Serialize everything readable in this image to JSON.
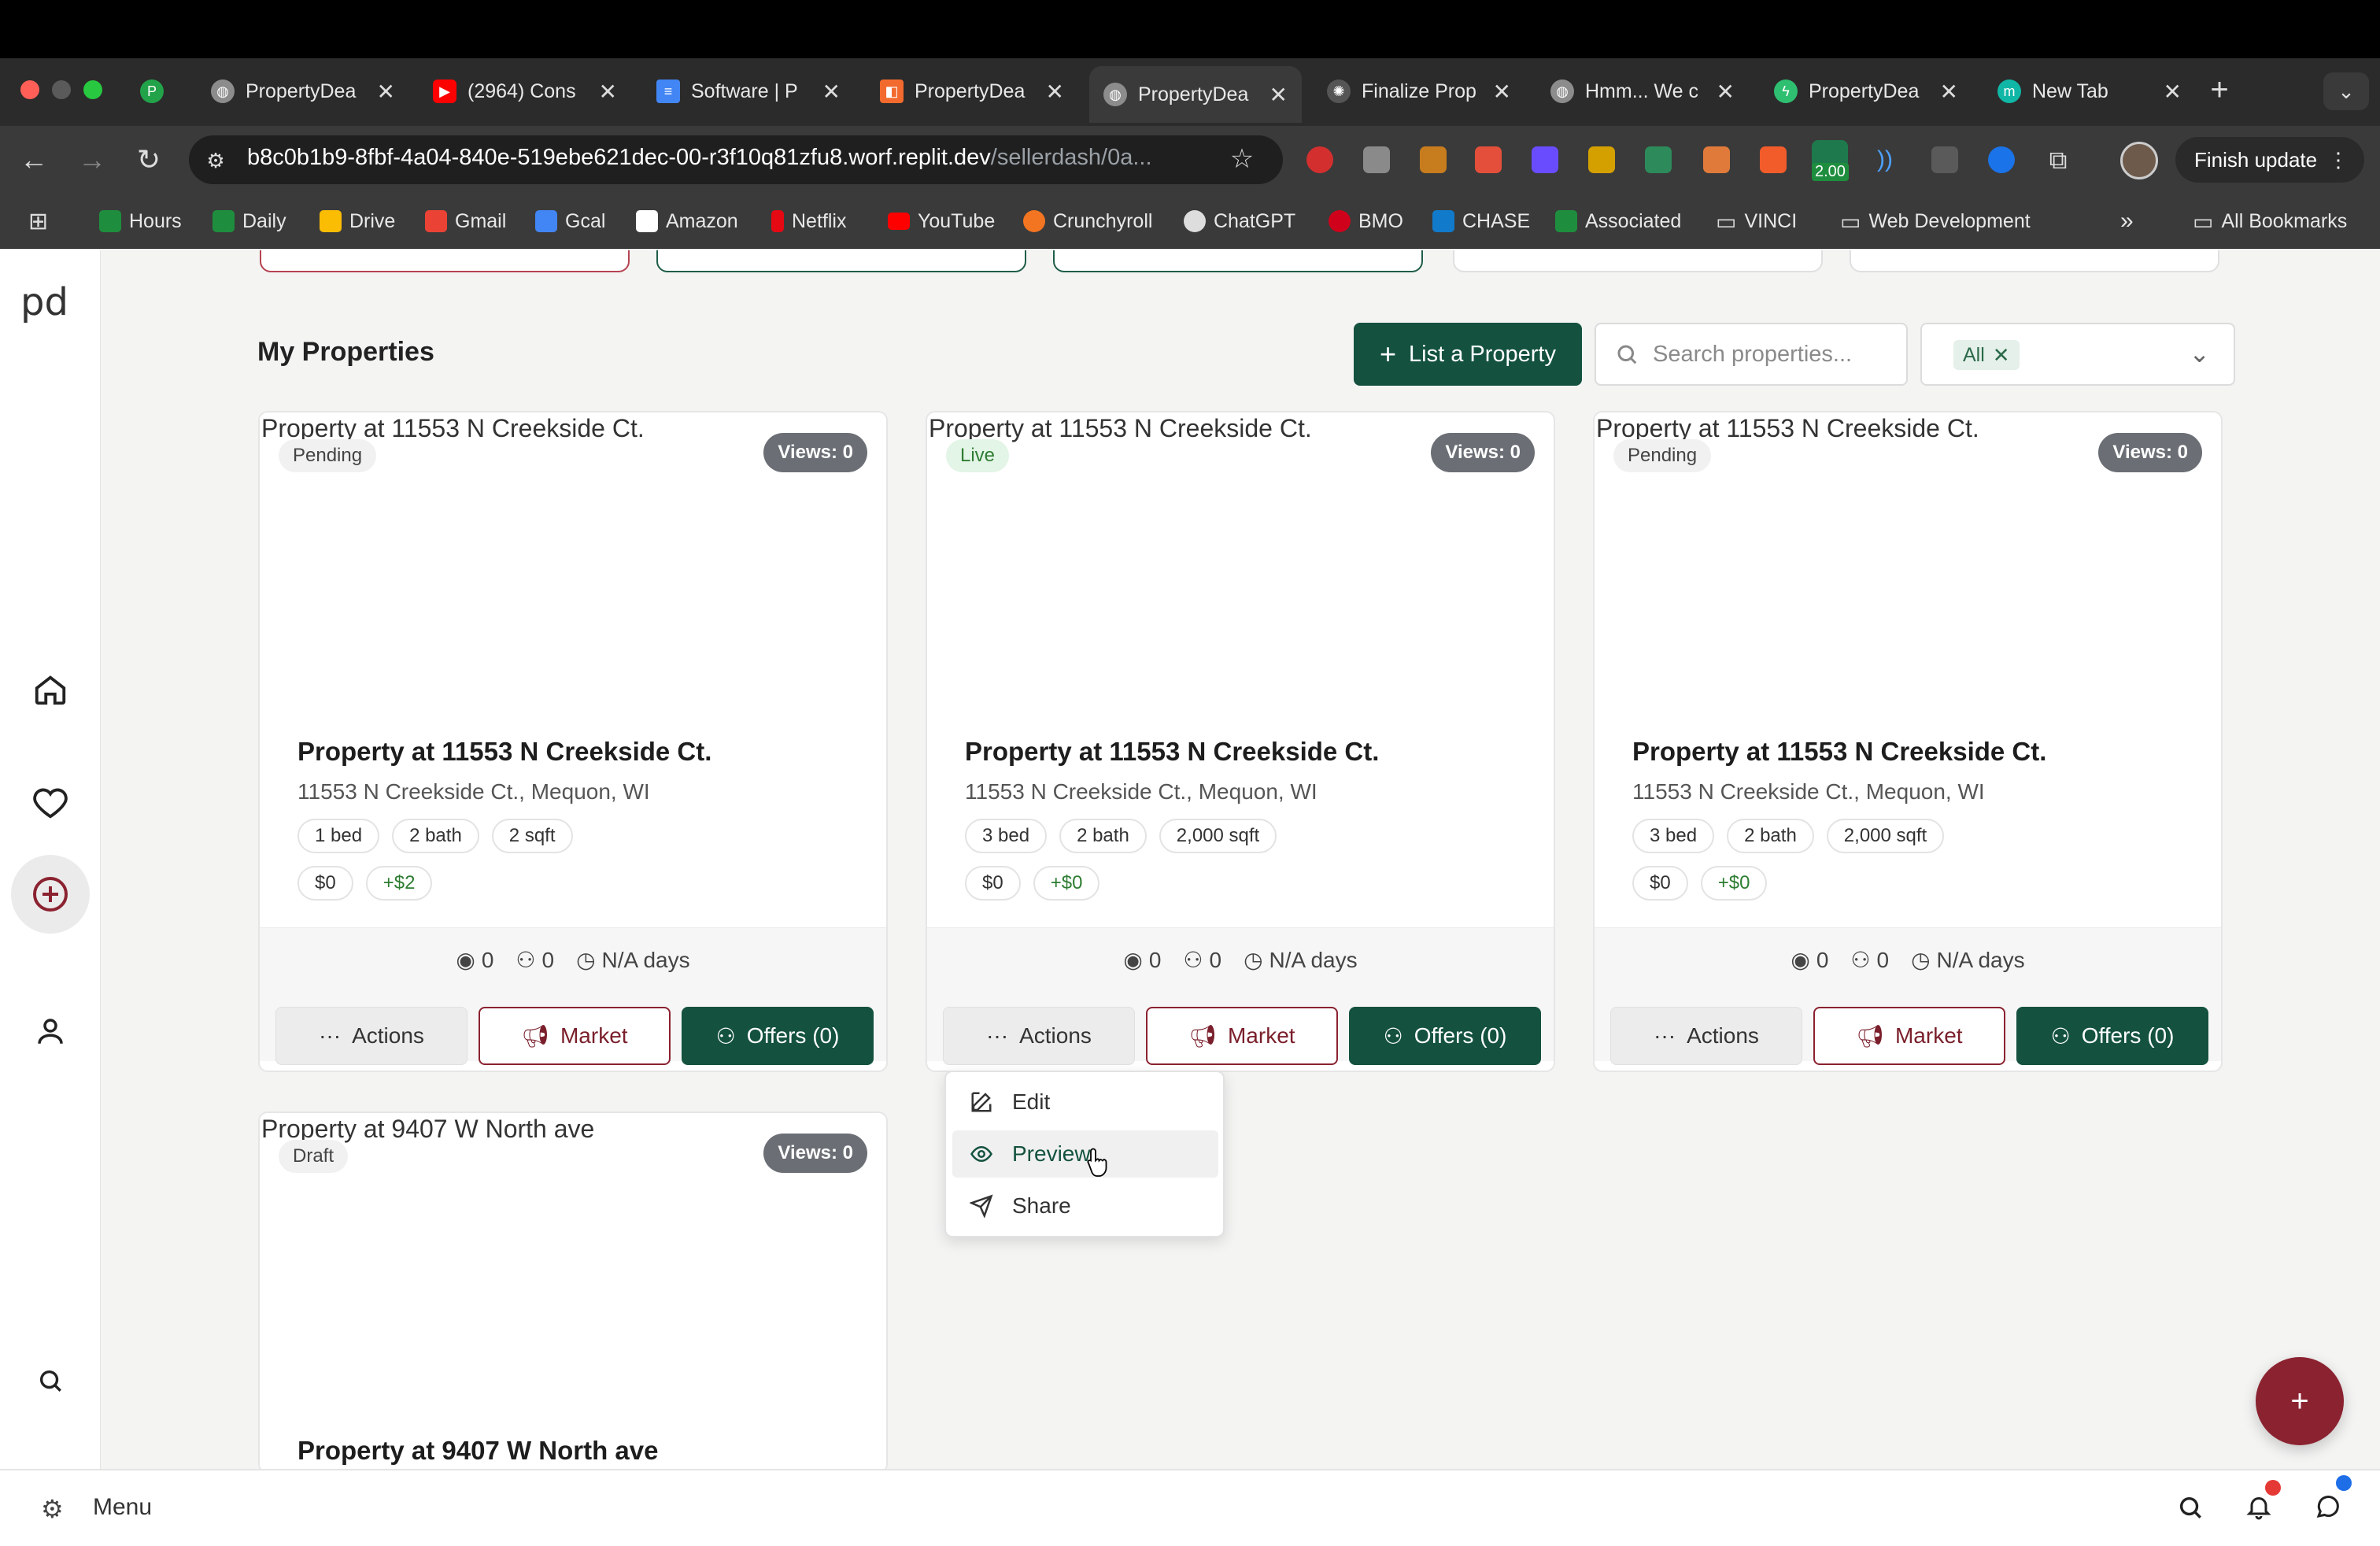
{
  "browser": {
    "tabs": [
      {
        "title": "",
        "favicon_color": "#22a34a",
        "favicon_letter": "P"
      },
      {
        "title": "PropertyDea",
        "favicon_color": "#8c8c8c"
      },
      {
        "title": "(2964) Cons",
        "favicon_color": "#ff0000"
      },
      {
        "title": "Software | P",
        "favicon_color": "#4285f4"
      },
      {
        "title": "PropertyDea",
        "favicon_color": "#f26a2e"
      },
      {
        "title": "PropertyDea",
        "favicon_color": "#8c8c8c",
        "active": true
      },
      {
        "title": "Finalize Prop",
        "favicon_color": "#dddddd"
      },
      {
        "title": "Hmm... We c",
        "favicon_color": "#8c8c8c"
      },
      {
        "title": "PropertyDea",
        "favicon_color": "#2fbf71"
      },
      {
        "title": "New Tab",
        "favicon_color": "#11b7a6",
        "favicon_letter": "m"
      }
    ],
    "url_main": "b8c0b1b9-8fbf-4a04-840e-519ebe621dec-00-r3f10q81zfu8.worf.replit.dev",
    "url_path": "/sellerdash/0a...",
    "extension_badge": "2.00",
    "finish_update": "Finish update",
    "bookmarks": [
      {
        "label": "Hours",
        "color": "#1e8e3e"
      },
      {
        "label": "Daily",
        "color": "#1e8e3e"
      },
      {
        "label": "Drive",
        "color": "#fbbc04"
      },
      {
        "label": "Gmail",
        "color": "#ea4335"
      },
      {
        "label": "Gcal",
        "color": "#4285f4"
      },
      {
        "label": "Amazon",
        "color": "#ffffff"
      },
      {
        "label": "Netflix",
        "color": "#e50914"
      },
      {
        "label": "YouTube",
        "color": "#ff0000"
      },
      {
        "label": "Crunchyroll",
        "color": "#f47521"
      },
      {
        "label": "ChatGPT",
        "color": "#dddddd"
      },
      {
        "label": "BMO",
        "color": "#d0021b"
      },
      {
        "label": "CHASE",
        "color": "#117aca"
      },
      {
        "label": "Associated",
        "color": "#1e8e3e"
      },
      {
        "label": "VINCI",
        "color": "folder"
      },
      {
        "label": "Web Development",
        "color": "folder"
      }
    ],
    "all_bookmarks": "All Bookmarks"
  },
  "app": {
    "logo": "pd",
    "page_title": "My Properties",
    "list_button": "List a Property",
    "search_placeholder": "Search properties...",
    "filter_chip": "All",
    "properties": [
      {
        "alt": "Property at 11553 N Creekside Ct.",
        "status": "Pending",
        "views": "Views: 0",
        "name": "Property at 11553 N Creekside Ct.",
        "address": "11553 N Creekside Ct., Mequon, WI",
        "beds": "1 bed",
        "baths": "2 bath",
        "sqft": "2 sqft",
        "price": "$0",
        "delta": "+$2",
        "stat_views": "0",
        "stat_users": "0",
        "stat_days": "N/A days",
        "actions": "Actions",
        "market": "Market",
        "offers": "Offers (0)"
      },
      {
        "alt": "Property at 11553 N Creekside Ct.",
        "status": "Live",
        "views": "Views: 0",
        "name": "Property at 11553 N Creekside Ct.",
        "address": "11553 N Creekside Ct., Mequon, WI",
        "beds": "3 bed",
        "baths": "2 bath",
        "sqft": "2,000 sqft",
        "price": "$0",
        "delta": "+$0",
        "stat_views": "0",
        "stat_users": "0",
        "stat_days": "N/A days",
        "actions": "Actions",
        "market": "Market",
        "offers": "Offers (0)"
      },
      {
        "alt": "Property at 11553 N Creekside Ct.",
        "status": "Pending",
        "views": "Views: 0",
        "name": "Property at 11553 N Creekside Ct.",
        "address": "11553 N Creekside Ct., Mequon, WI",
        "beds": "3 bed",
        "baths": "2 bath",
        "sqft": "2,000 sqft",
        "price": "$0",
        "delta": "+$0",
        "stat_views": "0",
        "stat_users": "0",
        "stat_days": "N/A days",
        "actions": "Actions",
        "market": "Market",
        "offers": "Offers (0)"
      },
      {
        "alt": "Property at 9407 W North ave",
        "status": "Draft",
        "views": "Views: 0",
        "name": "Property at 9407 W North ave"
      }
    ],
    "actions_menu": [
      {
        "label": "Edit",
        "icon": "edit-icon"
      },
      {
        "label": "Preview",
        "icon": "eye-icon"
      },
      {
        "label": "Share",
        "icon": "send-icon"
      }
    ],
    "fab": "+",
    "bottom_menu": "Menu",
    "colors": {
      "primary_green": "#14523f",
      "accent_maroon": "#8b2230"
    }
  }
}
